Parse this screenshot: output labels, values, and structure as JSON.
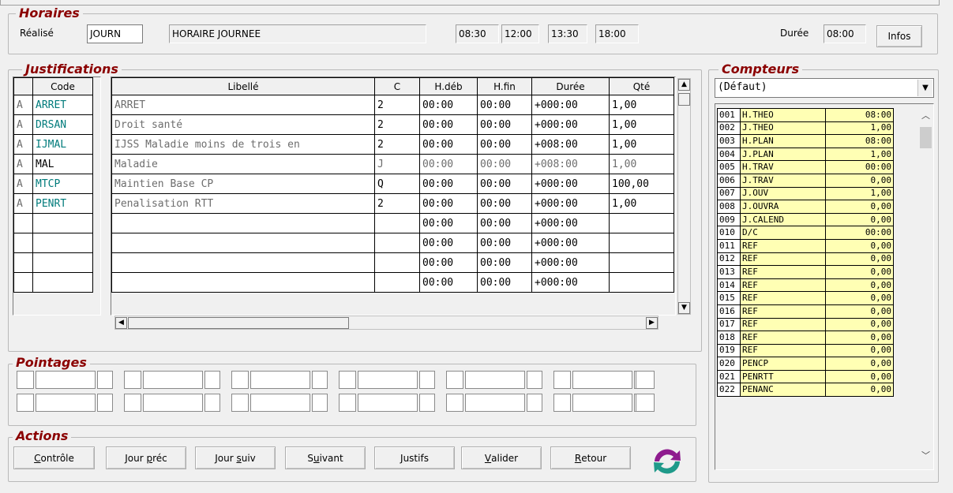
{
  "horaires": {
    "title": "Horaires",
    "realise_label": "Réalisé",
    "code": "JOURN",
    "libelle": "HORAIRE JOURNEE",
    "times": [
      "08:30",
      "12:00",
      "13:30",
      "18:00"
    ],
    "duree_label": "Durée",
    "duree": "08:00",
    "infos_label": "Infos"
  },
  "justifications": {
    "title": "Justifications",
    "headers": {
      "code": "Code",
      "libelle": "Libellé",
      "c": "C",
      "hdeb": "H.déb",
      "hfin": "H.fin",
      "duree": "Durée",
      "qte": "Qté"
    },
    "rows": [
      {
        "flag": "A",
        "code": "ARRET",
        "libelle": "ARRET",
        "c": "2",
        "hdeb": "00:00",
        "hfin": "00:00",
        "duree": "+000:00",
        "qte": "1,00",
        "style": "teal"
      },
      {
        "flag": "A",
        "code": "DRSAN",
        "libelle": "Droit santé",
        "c": "2",
        "hdeb": "00:00",
        "hfin": "00:00",
        "duree": "+000:00",
        "qte": "1,00",
        "style": "teal"
      },
      {
        "flag": "A",
        "code": "IJMAL",
        "libelle": "IJSS Maladie moins de trois en",
        "c": "2",
        "hdeb": "00:00",
        "hfin": "00:00",
        "duree": "+008:00",
        "qte": "1,00",
        "style": "teal"
      },
      {
        "flag": "A",
        "code": "MAL",
        "libelle": "Maladie",
        "c": "J",
        "hdeb": "00:00",
        "hfin": "00:00",
        "duree": "+008:00",
        "qte": "1,00",
        "style": "gray"
      },
      {
        "flag": "A",
        "code": "MTCP",
        "libelle": "Maintien Base CP",
        "c": "Q",
        "hdeb": "00:00",
        "hfin": "00:00",
        "duree": "+000:00",
        "qte": "100,00",
        "style": "teal"
      },
      {
        "flag": "A",
        "code": "PENRT",
        "libelle": "Penalisation RTT",
        "c": "2",
        "hdeb": "00:00",
        "hfin": "00:00",
        "duree": "+000:00",
        "qte": "1,00",
        "style": "teal"
      },
      {
        "flag": "",
        "code": "",
        "libelle": "",
        "c": "",
        "hdeb": "00:00",
        "hfin": "00:00",
        "duree": "+000:00",
        "qte": "",
        "style": ""
      },
      {
        "flag": "",
        "code": "",
        "libelle": "",
        "c": "",
        "hdeb": "00:00",
        "hfin": "00:00",
        "duree": "+000:00",
        "qte": "",
        "style": ""
      },
      {
        "flag": "",
        "code": "",
        "libelle": "",
        "c": "",
        "hdeb": "00:00",
        "hfin": "00:00",
        "duree": "+000:00",
        "qte": "",
        "style": ""
      },
      {
        "flag": "",
        "code": "",
        "libelle": "",
        "c": "",
        "hdeb": "00:00",
        "hfin": "00:00",
        "duree": "+000:00",
        "qte": "",
        "style": ""
      }
    ]
  },
  "pointages": {
    "title": "Pointages"
  },
  "actions": {
    "title": "Actions",
    "buttons": [
      {
        "pre": "",
        "u": "C",
        "post": "ontrôle"
      },
      {
        "pre": "Jour ",
        "u": "p",
        "post": "réc"
      },
      {
        "pre": "Jour ",
        "u": "s",
        "post": "uiv"
      },
      {
        "pre": "S",
        "u": "u",
        "post": "ivant"
      },
      {
        "pre": "",
        "u": "J",
        "post": "ustifs"
      },
      {
        "pre": "",
        "u": "V",
        "post": "alider"
      },
      {
        "pre": "",
        "u": "R",
        "post": "etour"
      }
    ],
    "refresh_icon": "refresh-icon"
  },
  "compteurs": {
    "title": "Compteurs",
    "selected": "(Défaut)",
    "rows": [
      {
        "num": "001",
        "name": "H.THEO",
        "value": "08:00"
      },
      {
        "num": "002",
        "name": "J.THEO",
        "value": "1,00"
      },
      {
        "num": "003",
        "name": "H.PLAN",
        "value": "08:00"
      },
      {
        "num": "004",
        "name": "J.PLAN",
        "value": "1,00"
      },
      {
        "num": "005",
        "name": "H.TRAV",
        "value": "00:00"
      },
      {
        "num": "006",
        "name": "J.TRAV",
        "value": "0,00"
      },
      {
        "num": "007",
        "name": "J.OUV",
        "value": "1,00"
      },
      {
        "num": "008",
        "name": "J.OUVRA",
        "value": "0,00"
      },
      {
        "num": "009",
        "name": "J.CALEND",
        "value": "0,00"
      },
      {
        "num": "010",
        "name": "D/C",
        "value": "00:00"
      },
      {
        "num": "011",
        "name": "REF",
        "value": "0,00"
      },
      {
        "num": "012",
        "name": "REF",
        "value": "0,00"
      },
      {
        "num": "013",
        "name": "REF",
        "value": "0,00"
      },
      {
        "num": "014",
        "name": "REF",
        "value": "0,00"
      },
      {
        "num": "015",
        "name": "REF",
        "value": "0,00"
      },
      {
        "num": "016",
        "name": "REF",
        "value": "0,00"
      },
      {
        "num": "017",
        "name": "REF",
        "value": "0,00"
      },
      {
        "num": "018",
        "name": "REF",
        "value": "0,00"
      },
      {
        "num": "019",
        "name": "REF",
        "value": "0,00"
      },
      {
        "num": "020",
        "name": "PENCP",
        "value": "0,00"
      },
      {
        "num": "021",
        "name": "PENRTT",
        "value": "0,00"
      },
      {
        "num": "022",
        "name": "PENANC",
        "value": "0,00"
      }
    ]
  }
}
